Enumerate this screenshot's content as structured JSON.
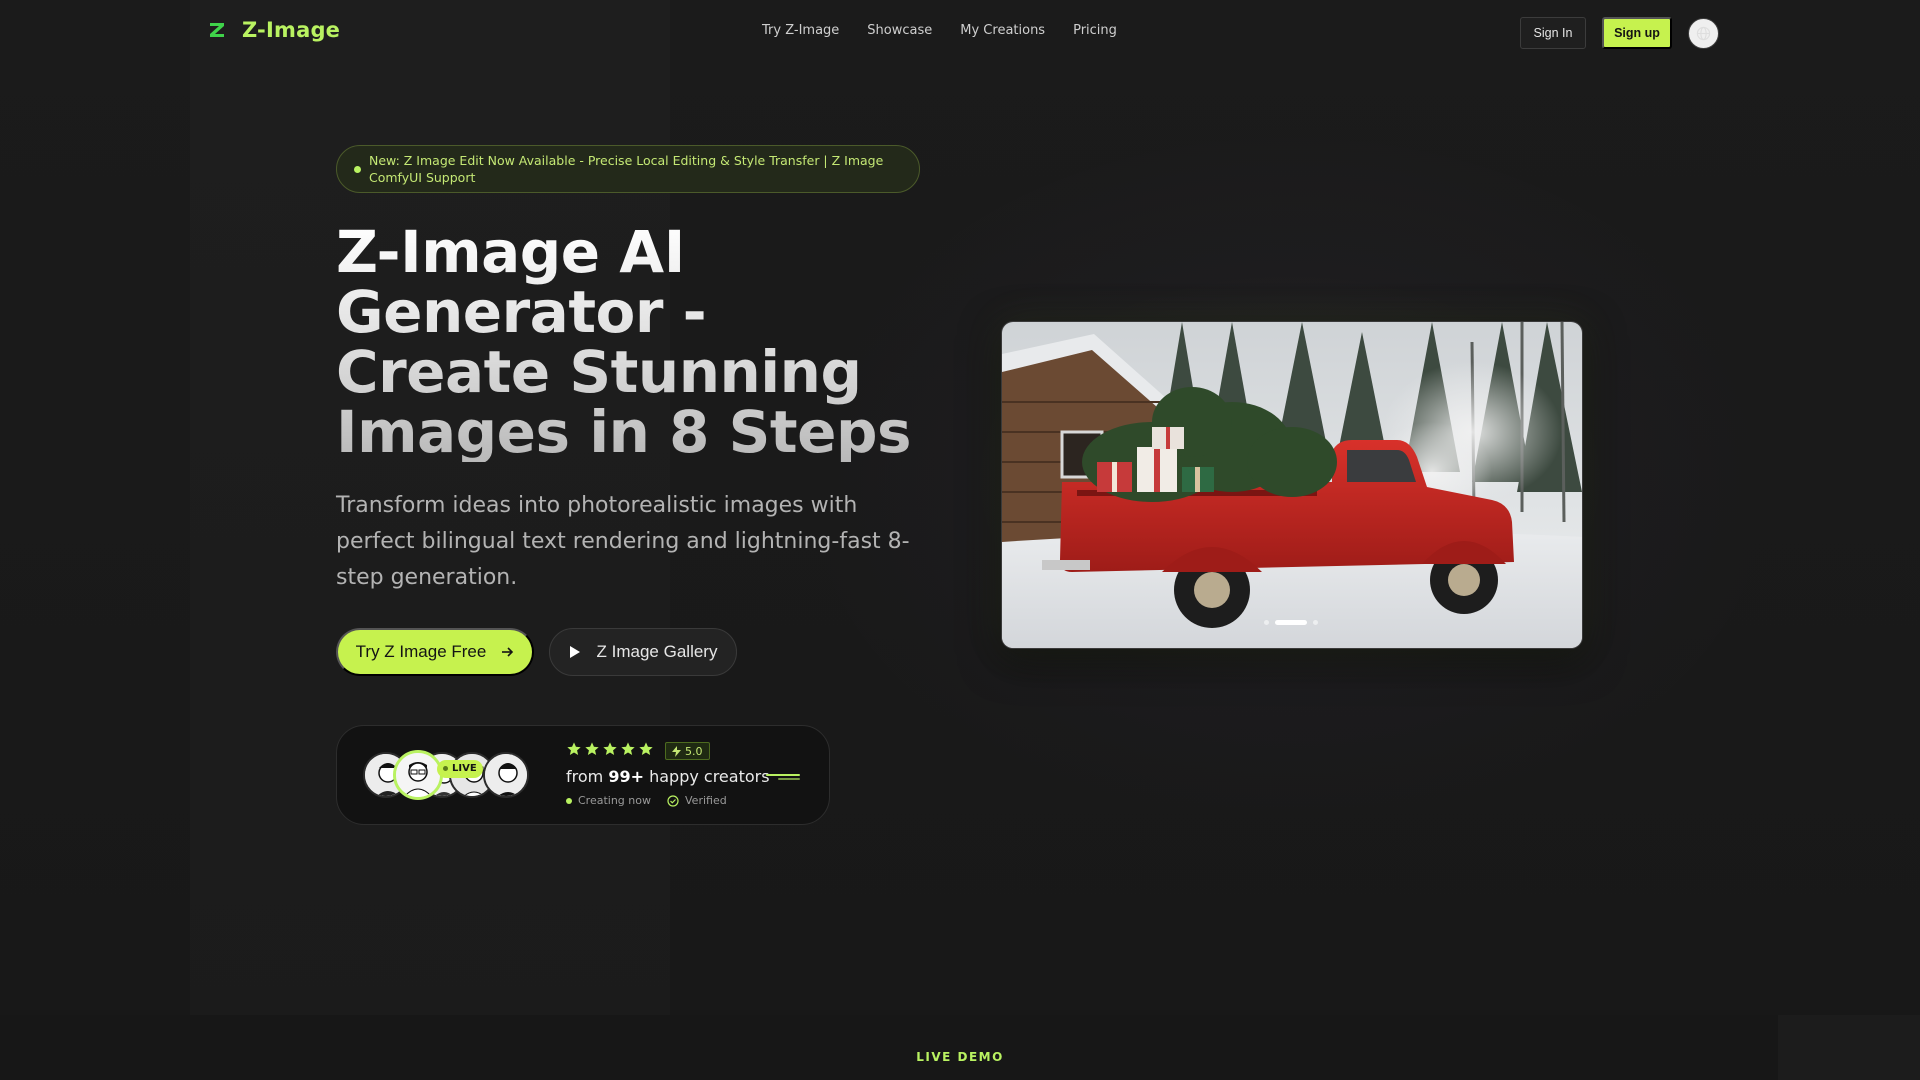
{
  "brand": {
    "name": "Z-Image",
    "logo_letter": "Z",
    "accent": "#c6f24e"
  },
  "nav": {
    "links": [
      "Try Z-Image",
      "Showcase",
      "My Creations",
      "Pricing"
    ],
    "sign_in": "Sign In",
    "sign_up": "Sign up",
    "language_icon": "globe-icon"
  },
  "announcement": {
    "text": "New: Z Image Edit Now Available - Precise Local Editing & Style Transfer | Z Image ComfyUI Support"
  },
  "hero": {
    "title": "Z-Image AI Generator - Create Stunning Images in 8 Steps",
    "subtitle": "Transform ideas into photorealistic images with perfect bilingual text rendering and lightning-fast 8-step generation.",
    "primary_cta": "Try Z Image Free",
    "secondary_cta": "Z Image Gallery"
  },
  "social_proof": {
    "live_label": "LIVE",
    "stars": 5,
    "rating": "5.0",
    "from_text": "from ",
    "count_text": "99+",
    "happy_text": " happy creators",
    "creating_now": "Creating now",
    "verified": "Verified"
  },
  "carousel": {
    "slide_count": 3,
    "active_slide": 2
  },
  "section_label": "LIVE DEMO"
}
